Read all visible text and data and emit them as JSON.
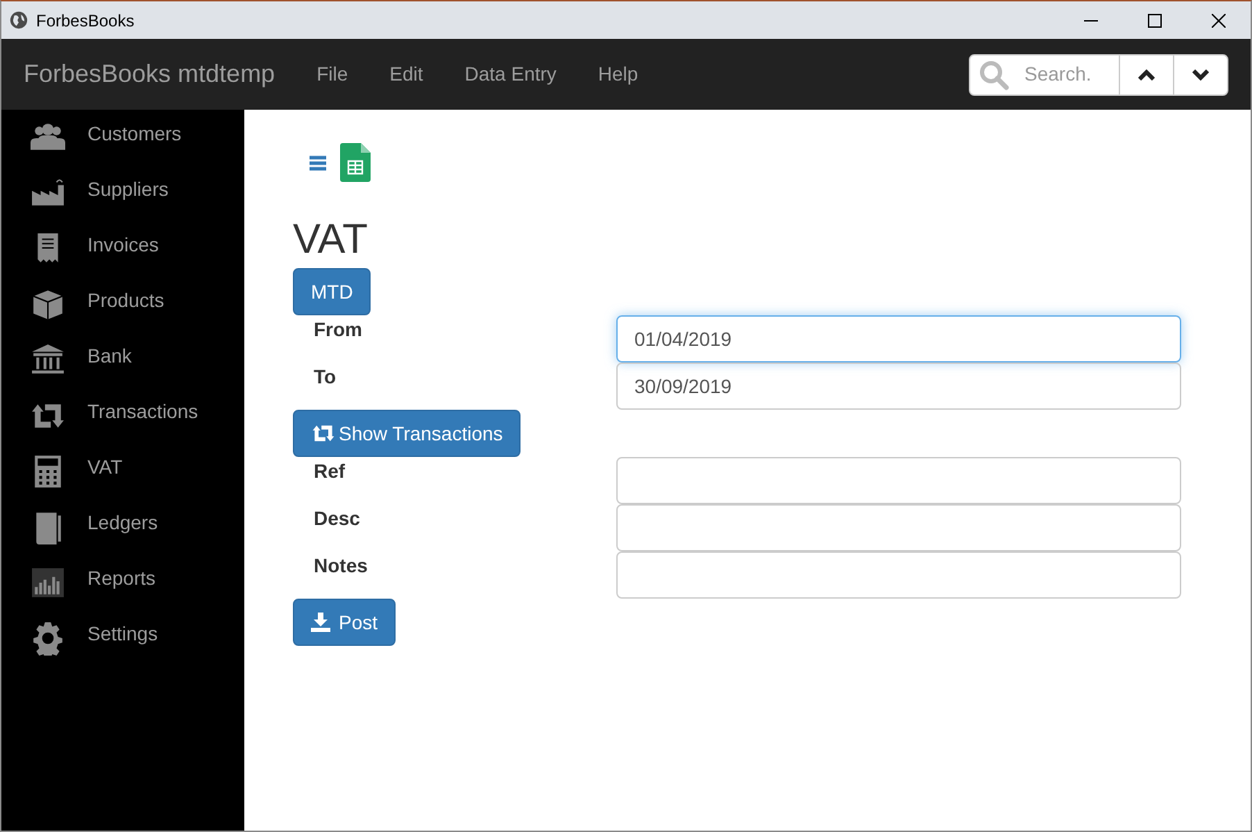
{
  "window": {
    "title": "ForbesBooks"
  },
  "navbar": {
    "brand": "ForbesBooks mtdtemp",
    "menu": [
      "File",
      "Edit",
      "Data Entry",
      "Help"
    ],
    "search": {
      "placeholder": "Search."
    }
  },
  "sidebar": {
    "items": [
      {
        "label": "Customers"
      },
      {
        "label": "Suppliers"
      },
      {
        "label": "Invoices"
      },
      {
        "label": "Products"
      },
      {
        "label": "Bank"
      },
      {
        "label": "Transactions"
      },
      {
        "label": "VAT"
      },
      {
        "label": "Ledgers"
      },
      {
        "label": "Reports"
      },
      {
        "label": "Settings"
      }
    ]
  },
  "page": {
    "title": "VAT",
    "rows": [
      {
        "kind": "button",
        "label": "MTD"
      },
      {
        "kind": "field",
        "label": "From",
        "value": "01/04/2019",
        "focused": true
      },
      {
        "kind": "field",
        "label": "To",
        "value": "30/09/2019",
        "focused": false
      },
      {
        "kind": "button",
        "label": "Show Transactions"
      },
      {
        "kind": "field",
        "label": "Ref",
        "focused": false
      },
      {
        "kind": "field",
        "label": "Desc",
        "focused": false
      },
      {
        "kind": "field",
        "label": "Notes",
        "focused": false
      },
      {
        "kind": "button",
        "label": "Post"
      }
    ]
  }
}
